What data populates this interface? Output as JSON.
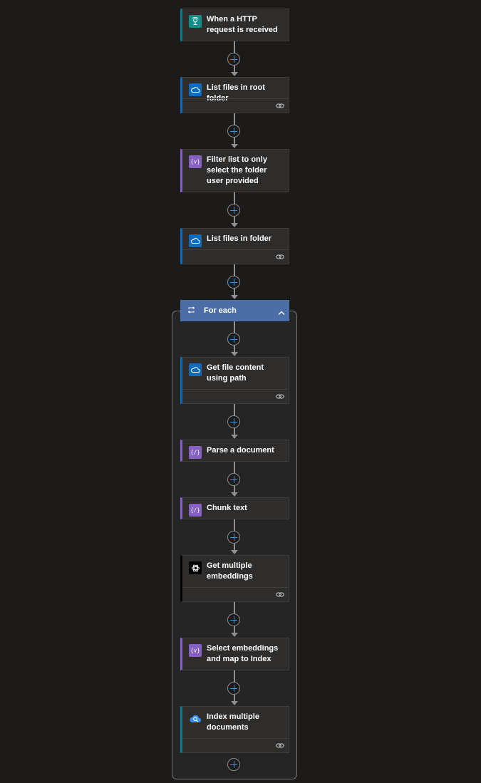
{
  "flow": {
    "trigger": {
      "title": "When a HTTP request is received",
      "icon": "http-request-icon",
      "accent": "#0e7a8a"
    },
    "actions": [
      {
        "title": "List files in root folder",
        "icon": "onedrive-cloud-icon",
        "accent": "#0f6cbd",
        "footer_icon": "link-icon"
      },
      {
        "title": "Filter list to only select the folder user provided",
        "icon": "data-operation-icon",
        "accent": "#8661c5"
      },
      {
        "title": "List files in folder",
        "icon": "onedrive-cloud-icon",
        "accent": "#0f6cbd",
        "footer_icon": "link-icon"
      }
    ],
    "foreach": {
      "title": "For each",
      "icon": "loop-icon",
      "collapse_icon": "chevron-up-icon",
      "color": "#4b6ea6",
      "actions": [
        {
          "title": "Get file content using path",
          "icon": "onedrive-cloud-icon",
          "accent": "#0f6cbd",
          "footer_icon": "link-icon"
        },
        {
          "title": "Parse a document",
          "icon": "data-operation-icon",
          "accent": "#8661c5"
        },
        {
          "title": "Chunk text",
          "icon": "data-operation-icon",
          "accent": "#8661c5"
        },
        {
          "title": "Get multiple embeddings",
          "icon": "openai-icon",
          "accent": "#000000",
          "footer_icon": "link-icon"
        },
        {
          "title": "Select embeddings and map to Index",
          "icon": "data-operation-icon",
          "accent": "#8661c5"
        },
        {
          "title": "Index multiple documents",
          "icon": "ai-search-icon",
          "accent": "#0e7a8a",
          "footer_icon": "link-icon"
        }
      ]
    }
  }
}
